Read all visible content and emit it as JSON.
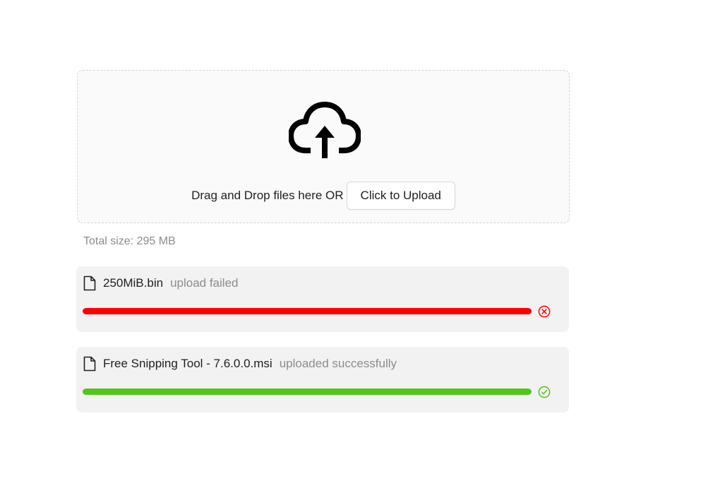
{
  "dropzone": {
    "icon": "cloud-upload-icon",
    "text": "Drag and Drop files here OR",
    "button_label": "Click to Upload"
  },
  "total_size_label": "Total size: 295 MB",
  "colors": {
    "error": "#ff0000",
    "success": "#52c41a",
    "muted_text": "#8c8c8c"
  },
  "files": [
    {
      "icon": "file-icon",
      "name": "250MiB.bin",
      "status": "upload failed",
      "progress": 1.0,
      "state": "error",
      "state_icon": "close-circle-icon"
    },
    {
      "icon": "file-icon",
      "name": "Free Snipping Tool - 7.6.0.0.msi",
      "status": "uploaded successfully",
      "progress": 1.0,
      "state": "success",
      "state_icon": "check-circle-icon"
    }
  ]
}
